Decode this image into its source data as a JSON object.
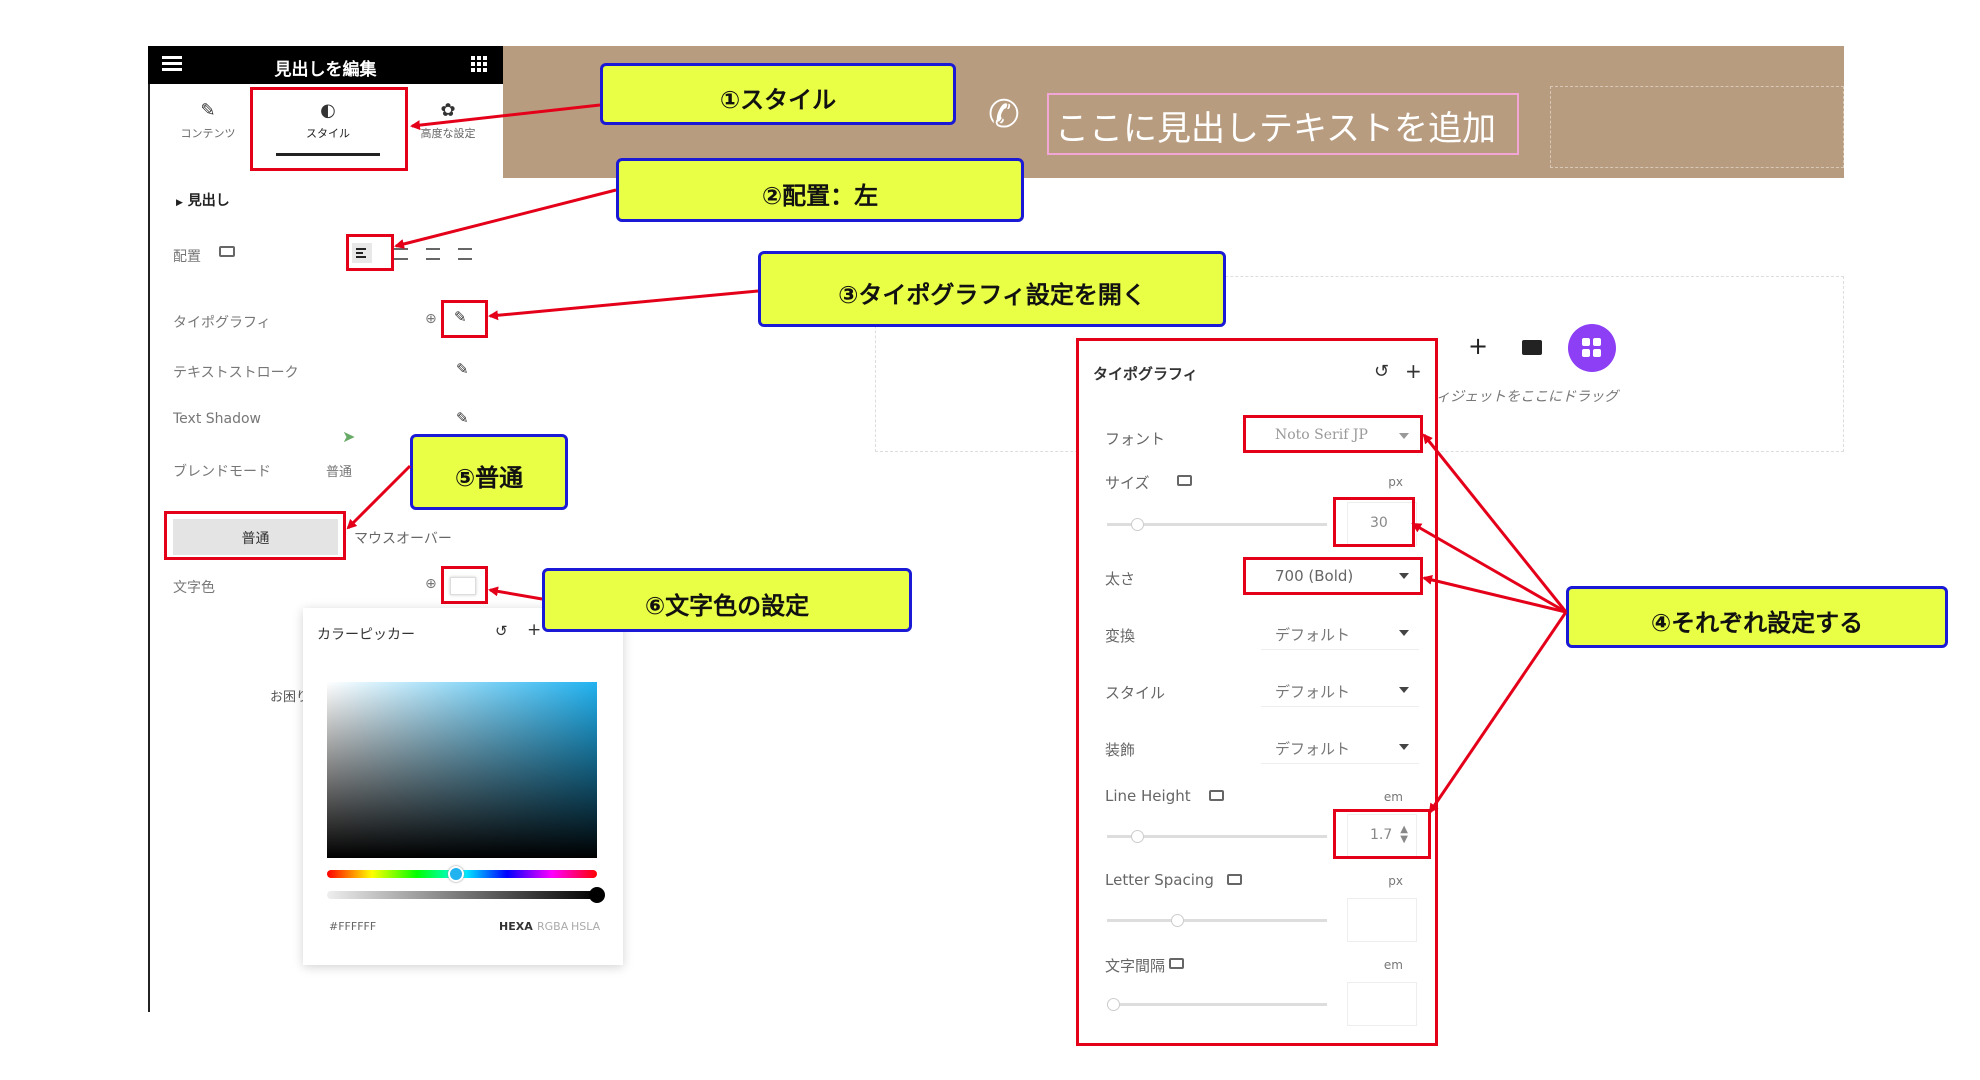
{
  "editor": {
    "title": "見出しを編集",
    "tabs": [
      {
        "label": "コンテンツ",
        "icon": "pencil-icon"
      },
      {
        "label": "スタイル",
        "icon": "contrast-icon"
      },
      {
        "label": "高度な設定",
        "icon": "gear-icon"
      }
    ],
    "section_title": "見出し",
    "alignment_label": "配置",
    "typography_label": "タイポグラフィ",
    "text_stroke_label": "テキストストローク",
    "text_shadow_label": "Text Shadow",
    "blend_mode_label": "ブレンドモード",
    "blend_mode_value": "普通",
    "state_tabs": [
      "普通",
      "マウスオーバー"
    ],
    "text_color_label": "文字色",
    "help_text": "お困り"
  },
  "color_picker": {
    "title": "カラーピッカー",
    "hex_value": "#FFFFFF",
    "modes": [
      "HEXA",
      "RGBA",
      "HSLA"
    ]
  },
  "canvas": {
    "heading_placeholder": "ここに見出しテキストを追加",
    "drop_hint": "ィジェットをここにドラッグ",
    "accent_color": "#8d3ff5",
    "banner_color": "#b89c7f"
  },
  "typography_popup": {
    "title": "タイポグラフィ",
    "font_label": "フォント",
    "font_value": "Noto Serif JP",
    "size_label": "サイズ",
    "size_unit": "px",
    "size_value": "30",
    "weight_label": "太さ",
    "weight_value": "700 (Bold)",
    "transform_label": "変換",
    "transform_value": "デフォルト",
    "style_label": "スタイル",
    "style_value": "デフォルト",
    "decoration_label": "装飾",
    "decoration_value": "デフォルト",
    "line_height_label": "Line Height",
    "line_height_unit": "em",
    "line_height_value": "1.7",
    "letter_spacing_label": "Letter Spacing",
    "letter_spacing_unit": "px",
    "word_spacing_label": "文字間隔",
    "word_spacing_unit": "em"
  },
  "callouts": {
    "c1": "①スタイル",
    "c2": "②配置：左",
    "c3": "③タイポグラフィ設定を開く",
    "c4": "④それぞれ設定する",
    "c5": "⑤普通",
    "c6": "⑥文字色の設定"
  },
  "colors": {
    "highlight_red": "#e5001a",
    "callout_fill": "#e9ff45",
    "callout_border": "#1a1ad6"
  }
}
